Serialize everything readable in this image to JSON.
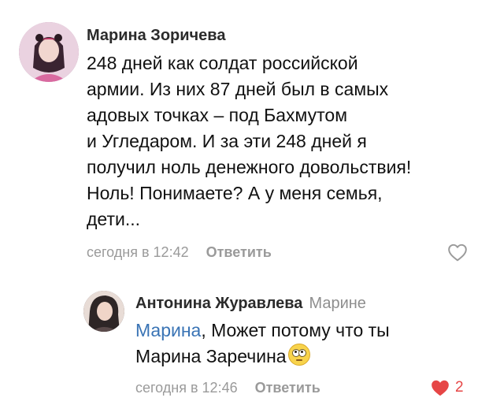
{
  "comments": [
    {
      "author": "Марина Зоричева",
      "avatar_icon": "avatar-photo",
      "text_lines": [
        "248 дней как солдат российской",
        "армии. Из них 87 дней был в самых",
        "адовых точках – под Бахмутом",
        "и Угледаром. И за эти 248 дней я",
        "получил ноль денежного довольствия!",
        "Ноль! Понимаете? А у меня семья,",
        "дети..."
      ],
      "time": "сегодня в 12:42",
      "reply_label": "Ответить",
      "like_icon": "heart-outline-icon",
      "liked": false
    }
  ],
  "reply": {
    "author": "Антонина Журавлева",
    "reply_to": "Марине",
    "avatar_icon": "avatar-photo",
    "mention": "Марина",
    "text_line1_rest": ", Может потому что ты",
    "text_line2": "Марина Заречина",
    "emoji_icon": "face-with-rolling-eyes-emoji",
    "time": "сегодня в 12:46",
    "reply_label": "Ответить",
    "like_icon": "heart-filled-icon",
    "liked": true,
    "like_count": "2"
  },
  "colors": {
    "mention": "#3a74b5",
    "liked_heart": "#e64646",
    "meta_text": "#9a9a9a"
  }
}
